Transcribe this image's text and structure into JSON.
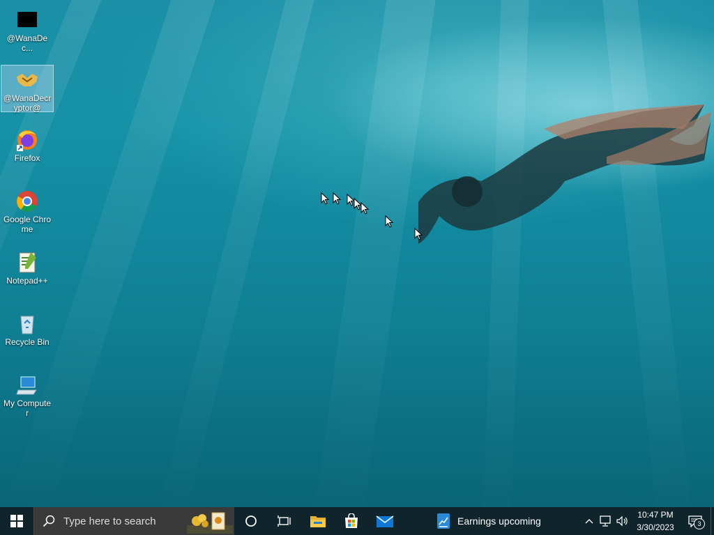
{
  "desktop": {
    "icons": [
      {
        "label": "@WanaDec...",
        "icon": "black-window-icon"
      },
      {
        "label": "@WanaDecryptor@",
        "icon": "wanadecryptor-handshake-icon"
      },
      {
        "label": "Firefox",
        "icon": "firefox-icon"
      },
      {
        "label": "Google Chrome",
        "icon": "chrome-icon"
      },
      {
        "label": "Notepad++",
        "icon": "notepadpp-icon"
      },
      {
        "label": "Recycle Bin",
        "icon": "recycle-bin-icon"
      },
      {
        "label": "My Computer",
        "icon": "my-computer-icon"
      }
    ]
  },
  "taskbar": {
    "search_placeholder": "Type here to search",
    "news_label": "Earnings upcoming",
    "clock_time": "10:47 PM",
    "clock_date": "3/30/2023",
    "notification_count": "3"
  },
  "colors": {
    "taskbar_bg": "#10242b",
    "search_bg": "#3a3a3a",
    "water_accent": "#1591a6"
  }
}
